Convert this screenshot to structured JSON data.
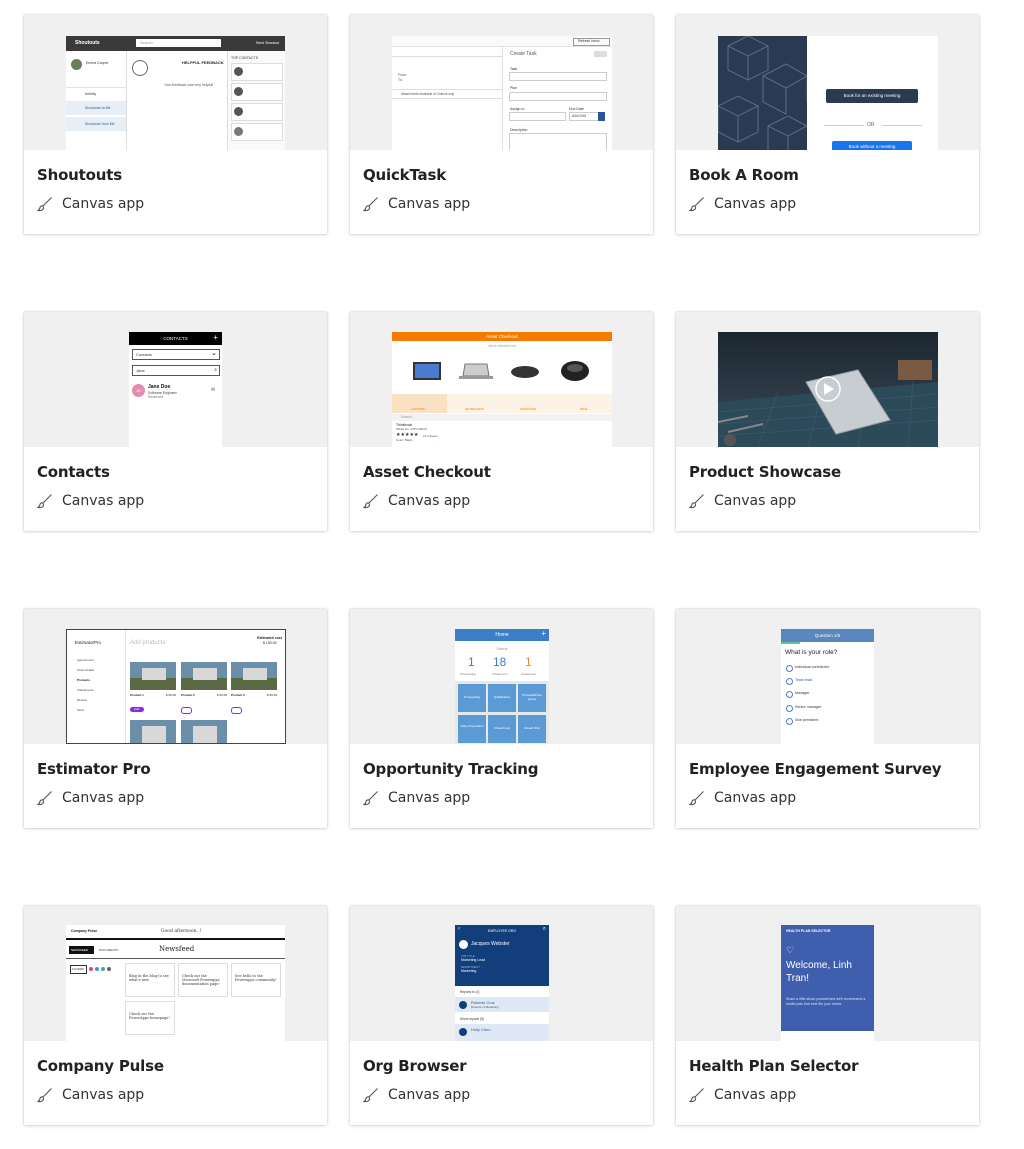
{
  "cards": [
    {
      "title": "Shoutouts",
      "type": "Canvas app",
      "preview": {
        "header": "Shoutouts",
        "search": "Search",
        "user": "Emma Cooper",
        "nav": [
          "Activity",
          "Shoutouts to Me",
          "Shoutouts from Me"
        ],
        "feedback": "HELPFUL FEEDBACK",
        "quote": "Your feedback was very helpful!",
        "side_title": "TOP CONTACTS",
        "send": "Send Shoutout"
      }
    },
    {
      "title": "QuickTask",
      "type": "Canvas app",
      "preview": {
        "heading": "Create Task",
        "fields": [
          "Task",
          "Plan",
          "Assign to",
          "Due Date",
          "Description"
        ],
        "note": "Attachments available in Outlook only",
        "from": "From:",
        "to": "To:",
        "date": "8/16/2018",
        "refresh": "Refresh inbox"
      }
    },
    {
      "title": "Book A Room",
      "type": "Canvas app",
      "preview": {
        "primary": "Book for an existing meeting",
        "divider": "OR",
        "secondary": "Book without a meeting"
      }
    },
    {
      "title": "Contacts",
      "type": "Canvas app",
      "preview": {
        "header": "CONTACTS",
        "dropdown": "Contacts",
        "search": "Jane",
        "name": "Jane Doe",
        "role": "Software Engineer",
        "loc": "Redmond",
        "initials": "JD"
      }
    },
    {
      "title": "Asset Checkout",
      "type": "Canvas app",
      "preview": {
        "header": "Asset Checkout",
        "sub": "Most checked out",
        "tabs": [
          "LAPTOPS",
          "KEYBOARDS",
          "MONITORS",
          "MICE"
        ],
        "search": "Search",
        "item": "Thinkbook",
        "model": "Model No: 1357-90018",
        "color": "Color: Black",
        "reviews": "21 reviews"
      }
    },
    {
      "title": "Product Showcase",
      "type": "Canvas app",
      "preview": {}
    },
    {
      "title": "Estimator Pro",
      "type": "Canvas app",
      "preview": {
        "logo": "EstimatorPro",
        "heading": "Add products",
        "cost_label": "Estimated cost",
        "cost": "$ 150.00",
        "nav": [
          "Appointment",
          "Order details",
          "Products",
          "Attachments",
          "Review",
          "Send"
        ],
        "products": [
          "Product 1",
          "Product 2",
          "Product 3"
        ],
        "prices": [
          "$ 50.00",
          "$ 50.00",
          "$ 50.00"
        ],
        "add": "Add"
      }
    },
    {
      "title": "Opportunity Tracking",
      "type": "Canvas app",
      "preview": {
        "header": "Home",
        "status": "Status",
        "stats": [
          {
            "n": "1",
            "l": "Prospecting"
          },
          {
            "n": "18",
            "l": "Closed won"
          },
          {
            "n": "1",
            "l": "Closed lost"
          }
        ],
        "tiles": [
          "Prospecting",
          "Qualification",
          "Proposal/Price Quote",
          "Value Proposition",
          "Closed Lost",
          "Closed Won"
        ]
      }
    },
    {
      "title": "Employee Engagement Survey",
      "type": "Canvas app",
      "preview": {
        "header": "Question 1/5",
        "question": "What is your role?",
        "options": [
          "Individual contributor",
          "Team lead",
          "Manager",
          "Senior manager",
          "Vice president"
        ]
      }
    },
    {
      "title": "Company Pulse",
      "type": "Canvas app",
      "preview": {
        "logo": "Company Pulse",
        "greeting": "Good afternoon, !",
        "tabs": [
          "NEWSFEED",
          "DOCUMENTS"
        ],
        "heading": "Newsfeed",
        "filters": "FILTERS",
        "posts": [
          "Blog in the blog to see what's new",
          "Check out the Microsoft Powerapps documentation page!",
          "See hello to the Powerapps community!",
          "Check out the PowerApps homepage!"
        ]
      }
    },
    {
      "title": "Org Browser",
      "type": "Canvas app",
      "preview": {
        "header": "EMPLOYEE ORG",
        "name": "Jacques Webster",
        "job_label": "JOB TITLE",
        "job": "Marketing Lead",
        "dept_label": "DEPARTMENT",
        "dept": "Marketing",
        "reports_to": "Reports to (1)",
        "manager": "Roberto Cruz",
        "manager_title": "Director of Marketing",
        "direct": "Direct reports (8)",
        "report1": "Holly Chen"
      }
    },
    {
      "title": "Health Plan Selector",
      "type": "Canvas app",
      "preview": {
        "header": "HEALTH PLAN SELECTOR",
        "welcome": "Welcome,  Linh Tran!",
        "body": "Share a little about yourself and we'll recommend a health plan that best fits your needs."
      }
    }
  ],
  "colors": {
    "orange": "#f37c00",
    "blue": "#2b579a",
    "navy": "#123e7c",
    "dark": "#3a3a3a"
  }
}
